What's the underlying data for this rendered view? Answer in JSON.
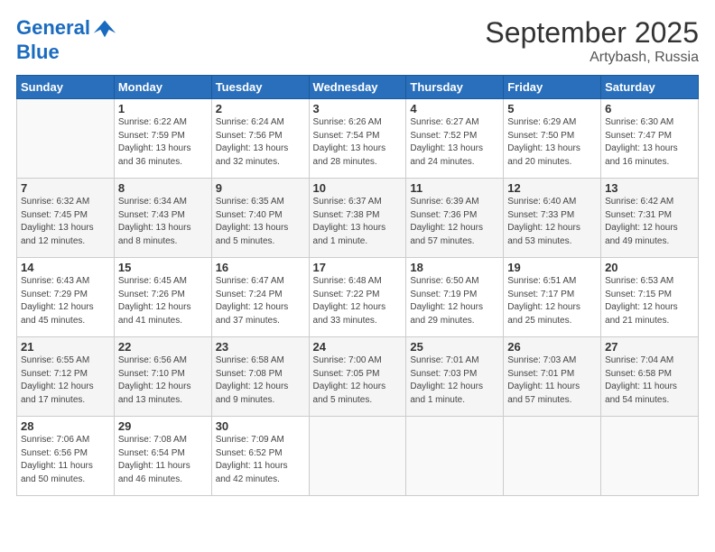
{
  "header": {
    "logo_line1": "General",
    "logo_line2": "Blue",
    "month": "September 2025",
    "location": "Artybash, Russia"
  },
  "weekdays": [
    "Sunday",
    "Monday",
    "Tuesday",
    "Wednesday",
    "Thursday",
    "Friday",
    "Saturday"
  ],
  "weeks": [
    [
      {
        "day": "",
        "info": ""
      },
      {
        "day": "1",
        "info": "Sunrise: 6:22 AM\nSunset: 7:59 PM\nDaylight: 13 hours\nand 36 minutes."
      },
      {
        "day": "2",
        "info": "Sunrise: 6:24 AM\nSunset: 7:56 PM\nDaylight: 13 hours\nand 32 minutes."
      },
      {
        "day": "3",
        "info": "Sunrise: 6:26 AM\nSunset: 7:54 PM\nDaylight: 13 hours\nand 28 minutes."
      },
      {
        "day": "4",
        "info": "Sunrise: 6:27 AM\nSunset: 7:52 PM\nDaylight: 13 hours\nand 24 minutes."
      },
      {
        "day": "5",
        "info": "Sunrise: 6:29 AM\nSunset: 7:50 PM\nDaylight: 13 hours\nand 20 minutes."
      },
      {
        "day": "6",
        "info": "Sunrise: 6:30 AM\nSunset: 7:47 PM\nDaylight: 13 hours\nand 16 minutes."
      }
    ],
    [
      {
        "day": "7",
        "info": "Sunrise: 6:32 AM\nSunset: 7:45 PM\nDaylight: 13 hours\nand 12 minutes."
      },
      {
        "day": "8",
        "info": "Sunrise: 6:34 AM\nSunset: 7:43 PM\nDaylight: 13 hours\nand 8 minutes."
      },
      {
        "day": "9",
        "info": "Sunrise: 6:35 AM\nSunset: 7:40 PM\nDaylight: 13 hours\nand 5 minutes."
      },
      {
        "day": "10",
        "info": "Sunrise: 6:37 AM\nSunset: 7:38 PM\nDaylight: 13 hours\nand 1 minute."
      },
      {
        "day": "11",
        "info": "Sunrise: 6:39 AM\nSunset: 7:36 PM\nDaylight: 12 hours\nand 57 minutes."
      },
      {
        "day": "12",
        "info": "Sunrise: 6:40 AM\nSunset: 7:33 PM\nDaylight: 12 hours\nand 53 minutes."
      },
      {
        "day": "13",
        "info": "Sunrise: 6:42 AM\nSunset: 7:31 PM\nDaylight: 12 hours\nand 49 minutes."
      }
    ],
    [
      {
        "day": "14",
        "info": "Sunrise: 6:43 AM\nSunset: 7:29 PM\nDaylight: 12 hours\nand 45 minutes."
      },
      {
        "day": "15",
        "info": "Sunrise: 6:45 AM\nSunset: 7:26 PM\nDaylight: 12 hours\nand 41 minutes."
      },
      {
        "day": "16",
        "info": "Sunrise: 6:47 AM\nSunset: 7:24 PM\nDaylight: 12 hours\nand 37 minutes."
      },
      {
        "day": "17",
        "info": "Sunrise: 6:48 AM\nSunset: 7:22 PM\nDaylight: 12 hours\nand 33 minutes."
      },
      {
        "day": "18",
        "info": "Sunrise: 6:50 AM\nSunset: 7:19 PM\nDaylight: 12 hours\nand 29 minutes."
      },
      {
        "day": "19",
        "info": "Sunrise: 6:51 AM\nSunset: 7:17 PM\nDaylight: 12 hours\nand 25 minutes."
      },
      {
        "day": "20",
        "info": "Sunrise: 6:53 AM\nSunset: 7:15 PM\nDaylight: 12 hours\nand 21 minutes."
      }
    ],
    [
      {
        "day": "21",
        "info": "Sunrise: 6:55 AM\nSunset: 7:12 PM\nDaylight: 12 hours\nand 17 minutes."
      },
      {
        "day": "22",
        "info": "Sunrise: 6:56 AM\nSunset: 7:10 PM\nDaylight: 12 hours\nand 13 minutes."
      },
      {
        "day": "23",
        "info": "Sunrise: 6:58 AM\nSunset: 7:08 PM\nDaylight: 12 hours\nand 9 minutes."
      },
      {
        "day": "24",
        "info": "Sunrise: 7:00 AM\nSunset: 7:05 PM\nDaylight: 12 hours\nand 5 minutes."
      },
      {
        "day": "25",
        "info": "Sunrise: 7:01 AM\nSunset: 7:03 PM\nDaylight: 12 hours\nand 1 minute."
      },
      {
        "day": "26",
        "info": "Sunrise: 7:03 AM\nSunset: 7:01 PM\nDaylight: 11 hours\nand 57 minutes."
      },
      {
        "day": "27",
        "info": "Sunrise: 7:04 AM\nSunset: 6:58 PM\nDaylight: 11 hours\nand 54 minutes."
      }
    ],
    [
      {
        "day": "28",
        "info": "Sunrise: 7:06 AM\nSunset: 6:56 PM\nDaylight: 11 hours\nand 50 minutes."
      },
      {
        "day": "29",
        "info": "Sunrise: 7:08 AM\nSunset: 6:54 PM\nDaylight: 11 hours\nand 46 minutes."
      },
      {
        "day": "30",
        "info": "Sunrise: 7:09 AM\nSunset: 6:52 PM\nDaylight: 11 hours\nand 42 minutes."
      },
      {
        "day": "",
        "info": ""
      },
      {
        "day": "",
        "info": ""
      },
      {
        "day": "",
        "info": ""
      },
      {
        "day": "",
        "info": ""
      }
    ]
  ]
}
